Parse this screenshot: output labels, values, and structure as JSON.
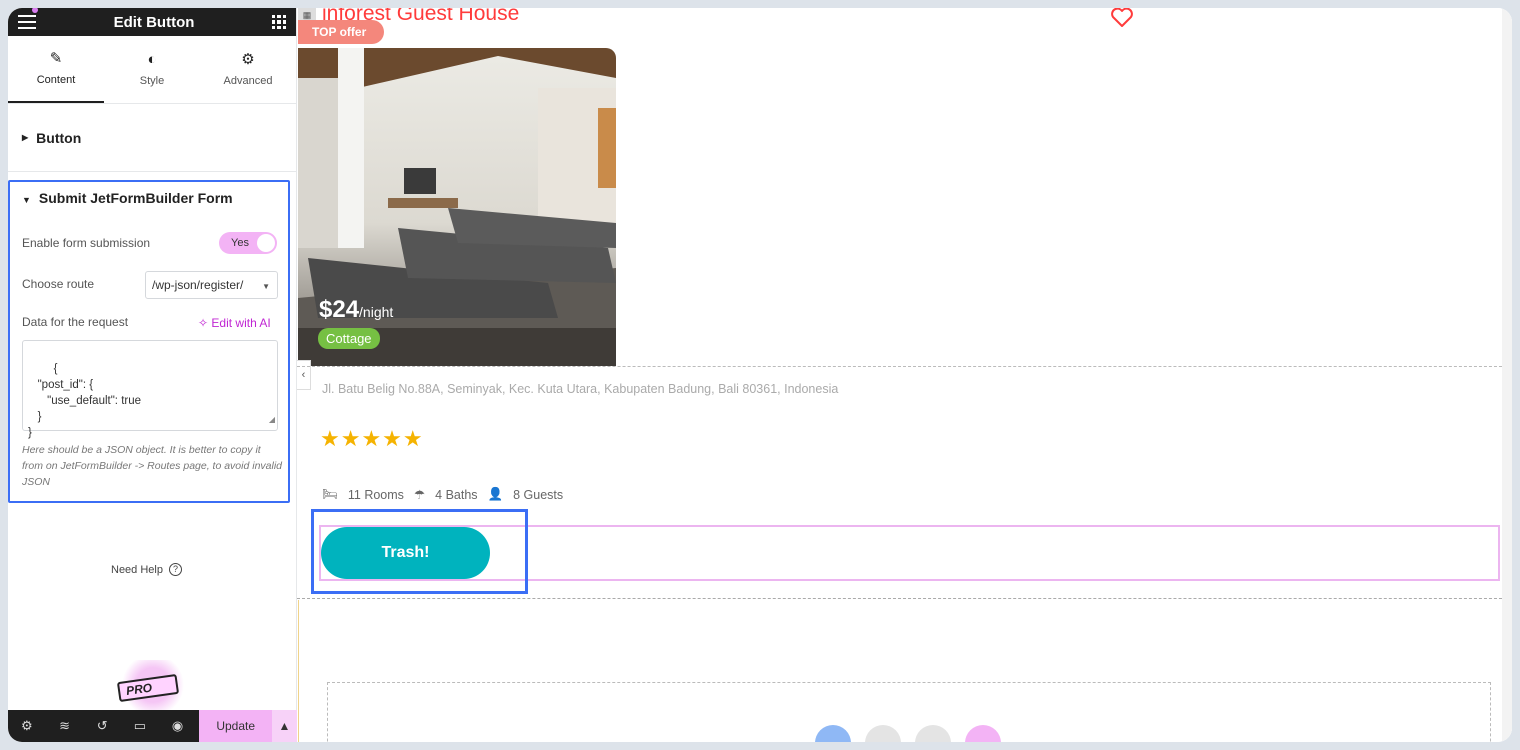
{
  "sidebar": {
    "title": "Edit Button",
    "tabs": [
      {
        "label": "Content",
        "icon": "pencil-icon"
      },
      {
        "label": "Style",
        "icon": "half-circle-icon"
      },
      {
        "label": "Advanced",
        "icon": "gear-icon"
      }
    ],
    "section_button": "Button",
    "section_submit": {
      "title": "Submit JetFormBuilder Form",
      "enable_label": "Enable form submission",
      "enable_value": "Yes",
      "route_label": "Choose route",
      "route_value": "/wp-json/register/",
      "data_label": "Data for the request",
      "ai_link": "Edit with AI",
      "json_value": "{\n   \"post_id\": {\n      \"use_default\": true\n   }\n}",
      "help_text": "Here should be a JSON object. It is better to copy it from on JetFormBuilder -> Routes page, to avoid invalid JSON"
    },
    "need_help": "Need Help",
    "pro_label": "PRO",
    "footer": {
      "update_label": "Update"
    }
  },
  "canvas": {
    "title": "inforest Guest House",
    "badge": "TOP offer",
    "price": "$24",
    "price_unit": "/night",
    "category": "Cottage",
    "address": "Jl. Batu Belig No.88A, Seminyak, Kec. Kuta Utara, Kabupaten Badung, Bali 80361, Indonesia",
    "stars": "★★★★★",
    "rooms": "11 Rooms",
    "baths": "4 Baths",
    "guests": "8 Guests",
    "button_label": "Trash!"
  },
  "colors": {
    "accent_blue": "#3b6ef5",
    "button_teal": "#00b3be",
    "pink": "#f3b3f5",
    "title_red": "#ff3b3b",
    "star": "#f5b301",
    "badge_green": "#76c043"
  }
}
